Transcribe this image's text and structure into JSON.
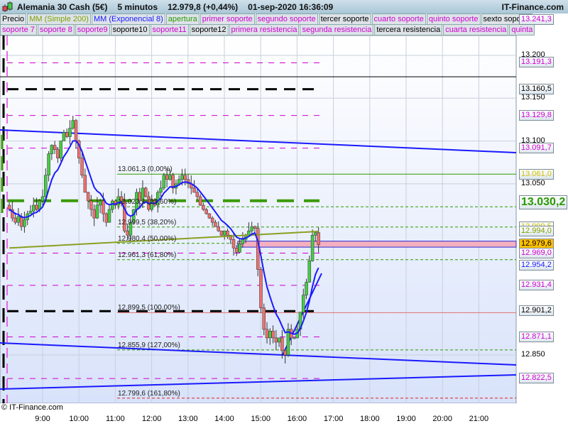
{
  "header": {
    "instrument": "Alemania 30 Cash (5€)",
    "timeframe": "5 minutos",
    "price": "12.979,8 (+0,44%)",
    "datetime": "01-sep-2020 16:36:09",
    "brand": "IT-Finance.com"
  },
  "legend_row1": [
    {
      "label": "Precio",
      "color": "#000000"
    },
    {
      "label": "MM (Simple 200)",
      "color": "#7fa000"
    },
    {
      "label": "MM (Exponencial 8)",
      "color": "#1a1aff"
    },
    {
      "label": "apertura",
      "color": "#2a9a00"
    },
    {
      "label": "primer soporte",
      "color": "#d000d0"
    },
    {
      "label": "segundo soporte",
      "color": "#d000d0"
    },
    {
      "label": "tercer soporte",
      "color": "#000000"
    },
    {
      "label": "cuarto soporte",
      "color": "#d000d0"
    },
    {
      "label": "quinto soporte",
      "color": "#d000d0"
    },
    {
      "label": "sexto soporte",
      "color": "#000000"
    }
  ],
  "legend_row2": [
    {
      "label": "soporte 7",
      "color": "#d000d0"
    },
    {
      "label": "soporte 8",
      "color": "#d000d0"
    },
    {
      "label": "soporte9",
      "color": "#d000d0"
    },
    {
      "label": "soporte10",
      "color": "#000000"
    },
    {
      "label": "soporte11",
      "color": "#d000d0"
    },
    {
      "label": "soporte12",
      "color": "#000000"
    },
    {
      "label": "primera resistencia",
      "color": "#d000d0"
    },
    {
      "label": "segunda resistencia",
      "color": "#d000d0"
    },
    {
      "label": "tercera resistencia",
      "color": "#000000"
    },
    {
      "label": "cuarta resistencia",
      "color": "#d000d0"
    },
    {
      "label": "quinta",
      "color": "#d000d0"
    }
  ],
  "price_labels": [
    {
      "value": "13.241,3",
      "price": 13241.3,
      "color": "#d000d0"
    },
    {
      "value": "13.191,3",
      "price": 13191.3,
      "color": "#d000d0"
    },
    {
      "value": "13.160,5",
      "price": 13160.5,
      "color": "#000000"
    },
    {
      "value": "13.129,8",
      "price": 13129.8,
      "color": "#d000d0"
    },
    {
      "value": "13.091,7",
      "price": 13091.7,
      "color": "#d000d0"
    },
    {
      "value": "13.061,0",
      "price": 13061.0,
      "color": "#d0c000"
    },
    {
      "value": "13.030,2",
      "price": 13030.2,
      "color": "#2a9a00"
    },
    {
      "value": "12.999,5",
      "price": 12999.5,
      "color": "#d0c000"
    },
    {
      "value": "12.994,0",
      "price": 12994.0,
      "color": "#7fa000"
    },
    {
      "value": "12.979,6",
      "price": 12979.6,
      "color": "#000000"
    },
    {
      "value": "12.969,0",
      "price": 12969.0,
      "color": "#d000d0"
    },
    {
      "value": "12.954,2",
      "price": 12954.2,
      "color": "#1a1aff"
    },
    {
      "value": "12.931,4",
      "price": 12931.4,
      "color": "#d000d0"
    },
    {
      "value": "12.901,2",
      "price": 12901.2,
      "color": "#000000"
    },
    {
      "value": "12.871,1",
      "price": 12871.1,
      "color": "#d000d0"
    },
    {
      "value": "12.822,5",
      "price": 12822.5,
      "color": "#d000d0"
    }
  ],
  "y_ticks": [
    "13.200",
    "13.150",
    "13.100",
    "13.050",
    "12.850"
  ],
  "y_tick_values": [
    13200,
    13150,
    13100,
    13050,
    12850
  ],
  "x_ticks": [
    "9:00",
    "10:00",
    "11:00",
    "12:00",
    "13:00",
    "14:00",
    "15:00",
    "16:00",
    "17:00",
    "18:00",
    "19:00",
    "20:00",
    "21:00"
  ],
  "fib_levels": [
    {
      "label": "13.061,3 (0,00%)",
      "price": 13061.3
    },
    {
      "label": "13.023,1 (23,60%)",
      "price": 13023.1
    },
    {
      "label": "12.999,5 (38,20%)",
      "price": 12999.5
    },
    {
      "label": "12.980,4 (50,00%)",
      "price": 12980.4
    },
    {
      "label": "12.961,3 (61,80%)",
      "price": 12961.3
    },
    {
      "label": "12.899,5 (100,00%)",
      "price": 12899.5
    },
    {
      "label": "12.855,9 (127,00%)",
      "price": 12855.9
    },
    {
      "label": "12.799,6 (161,80%)",
      "price": 12799.6
    }
  ],
  "watermark": "© IT-Finance.com",
  "colors": {
    "up": "#44cc44",
    "down": "#ee7070",
    "ema": "#1a1aff",
    "sma": "#8aa020",
    "current_price_bg": "#ffc000"
  },
  "chart_data": {
    "type": "candlestick",
    "closes": [
      13020,
      13010,
      13005,
      13012,
      13000,
      13008,
      13015,
      13018,
      13025,
      13020,
      13030,
      13035,
      13060,
      13085,
      13095,
      13090,
      13080,
      13100,
      13110,
      13105,
      13115,
      13124,
      13100,
      13080,
      13060,
      13040,
      13030,
      13020,
      13010,
      13025,
      13030,
      13015,
      13005,
      13020,
      13030,
      13025,
      13035,
      13030,
      12995,
      12990,
      13005,
      13020,
      13040,
      13030,
      13045,
      13035,
      13020,
      13030,
      13025,
      13040,
      13045,
      13060,
      13055,
      13060,
      13045,
      13050,
      13055,
      13060,
      13055,
      13050,
      13045,
      13040,
      13035,
      13025,
      13020,
      13015,
      13010,
      13005,
      13000,
      12995,
      12990,
      12995,
      12990,
      12985,
      12975,
      12970,
      12980,
      12985,
      12990,
      12995,
      13000,
      12998,
      12950,
      12905,
      12880,
      12870,
      12878,
      12870,
      12865,
      12870,
      12855,
      12850,
      12880,
      12870,
      12870,
      12880,
      12900,
      12920,
      12935,
      12960,
      12990,
      12993,
      12979
    ]
  }
}
